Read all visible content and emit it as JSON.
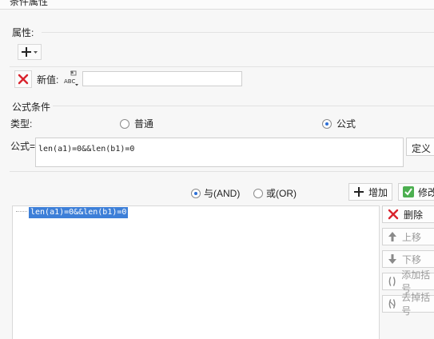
{
  "dialog": {
    "title": "条件属性"
  },
  "properties": {
    "section_label": "属性:",
    "add_button_icon": "plus-icon",
    "delete_icon": "red-x-icon",
    "new_value_label": "新值:",
    "value_type_icon": "abc-text-type-icon",
    "new_value_input": ""
  },
  "formula_condition": {
    "section_label": "公式条件",
    "type_label": "类型:",
    "type_options": [
      {
        "label": "普通",
        "selected": false
      },
      {
        "label": "公式",
        "selected": true
      }
    ],
    "formula_label": "公式=",
    "formula_value": "len(a1)=0&&len(b1)=0",
    "define_button": "定义"
  },
  "logic": {
    "options": [
      {
        "label": "与(AND)",
        "selected": true
      },
      {
        "label": "或(OR)",
        "selected": false
      }
    ],
    "add_button": "增加",
    "modify_button": "修改"
  },
  "conditions_list": {
    "items": [
      "len(a1)=0&&len(b1)=0"
    ]
  },
  "side_buttons": [
    {
      "label": "删除",
      "icon": "red-x-icon",
      "enabled": true
    },
    {
      "label": "上移",
      "icon": "arrow-up-icon",
      "enabled": false
    },
    {
      "label": "下移",
      "icon": "arrow-down-icon",
      "enabled": false
    },
    {
      "label": "添加括号",
      "icon": "parentheses-icon",
      "enabled": false
    },
    {
      "label": "去掉括号",
      "icon": "remove-parentheses-icon",
      "enabled": false
    }
  ],
  "colors": {
    "accent": "#2d6fd6",
    "delete_red": "#d9232d",
    "selection": "#3d7fd8"
  }
}
